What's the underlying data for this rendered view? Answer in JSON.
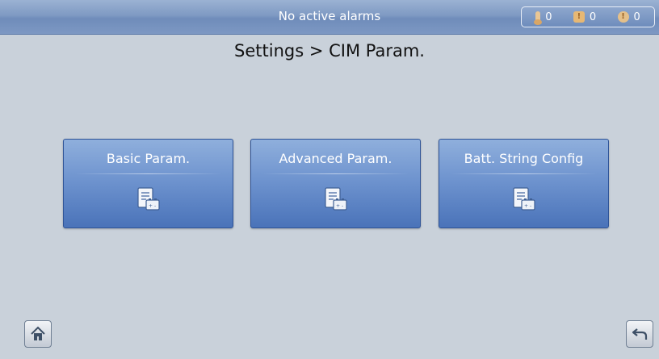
{
  "header": {
    "alarm_status": "No active alarms",
    "counters": [
      {
        "icon": "thermometer-alarm-icon",
        "count": "0"
      },
      {
        "icon": "exclamation-square-icon",
        "count": "0"
      },
      {
        "icon": "exclamation-circle-icon",
        "count": "0"
      }
    ]
  },
  "page": {
    "title": "Settings > CIM Param."
  },
  "menu": {
    "items": [
      {
        "label": "Basic Param.",
        "icon": "document-battery-icon"
      },
      {
        "label": "Advanced Param.",
        "icon": "document-battery-icon"
      },
      {
        "label": "Batt. String Config",
        "icon": "document-battery-icon"
      }
    ]
  },
  "nav": {
    "home_icon": "home-icon",
    "back_icon": "back-arrow-icon"
  },
  "colors": {
    "button_blue": "#5a7fc0",
    "background": "#c9d1da",
    "header_blue": "#7f9ac3"
  }
}
